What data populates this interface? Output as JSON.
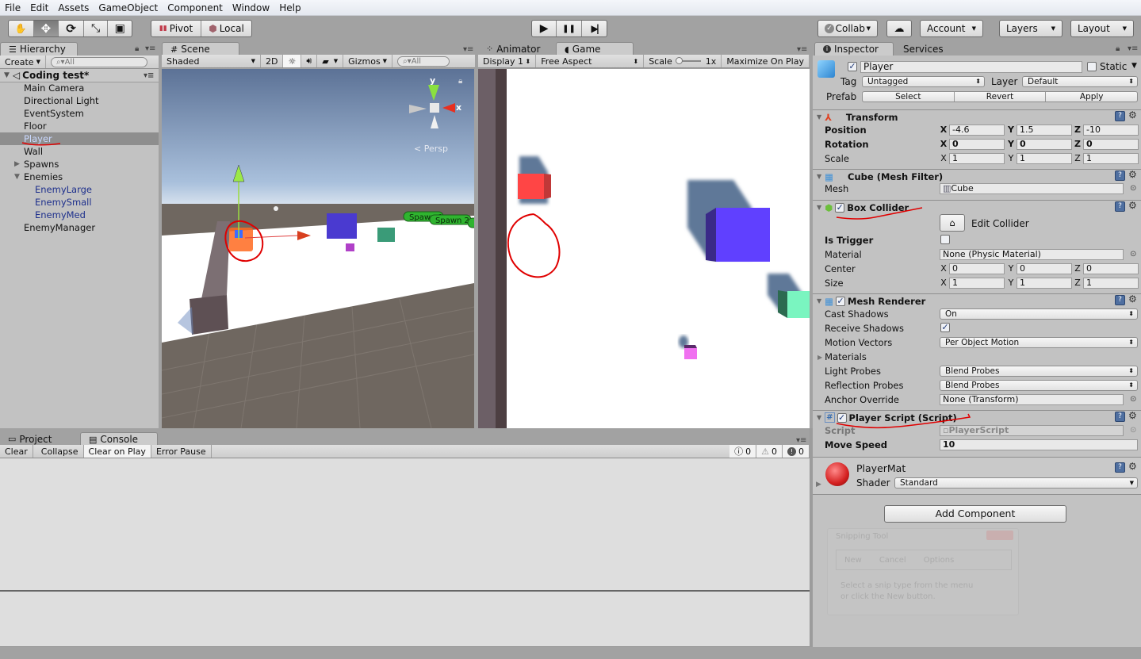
{
  "menu": [
    "File",
    "Edit",
    "Assets",
    "GameObject",
    "Component",
    "Window",
    "Help"
  ],
  "toolbar": {
    "tools": [
      {
        "name": "hand-tool",
        "icon": "✋"
      },
      {
        "name": "move-tool",
        "icon": "✥"
      },
      {
        "name": "rotate-tool",
        "icon": "⟳"
      },
      {
        "name": "scale-tool",
        "icon": "⤡"
      },
      {
        "name": "rect-tool",
        "icon": "▣"
      }
    ],
    "pivot_label": "Pivot",
    "local_label": "Local",
    "play_icon": "▶",
    "pause_icon": "❚❚",
    "step_icon": "▶|",
    "collab_label": "Collab",
    "cloud_icon": "☁",
    "account_label": "Account",
    "layers_label": "Layers",
    "layout_label": "Layout"
  },
  "hierarchy": {
    "tab_label": "Hierarchy",
    "create_label": "Create",
    "search_placeholder": "All",
    "scene_name": "Coding test*",
    "items": [
      {
        "label": "Main Camera",
        "indent": 0,
        "state": "normal"
      },
      {
        "label": "Directional Light",
        "indent": 0,
        "state": "normal"
      },
      {
        "label": "EventSystem",
        "indent": 0,
        "state": "normal"
      },
      {
        "label": "Floor",
        "indent": 0,
        "state": "normal"
      },
      {
        "label": "Player",
        "indent": 0,
        "state": "selected"
      },
      {
        "label": "Wall",
        "indent": 0,
        "state": "normal"
      },
      {
        "label": "Spawns",
        "indent": 0,
        "state": "collapsed"
      },
      {
        "label": "Enemies",
        "indent": 0,
        "state": "expanded"
      },
      {
        "label": "EnemyLarge",
        "indent": 1,
        "state": "prefab"
      },
      {
        "label": "EnemySmall",
        "indent": 1,
        "state": "prefab"
      },
      {
        "label": "EnemyMed",
        "indent": 1,
        "state": "prefab"
      },
      {
        "label": "EnemyManager",
        "indent": 0,
        "state": "normal"
      }
    ]
  },
  "scene": {
    "tab_label": "Scene",
    "shading_mode": "Shaded",
    "mode_2d_label": "2D",
    "gizmos_label": "Gizmos",
    "search_placeholder": "All",
    "persp_label": "Persp",
    "axis_y": "y",
    "axis_x": "x",
    "spawn_labels": [
      "Spawn 1",
      "Spawn 2",
      "S"
    ]
  },
  "game": {
    "animator_tab_label": "Animator",
    "tab_label": "Game",
    "display": "Display 1",
    "aspect": "Free Aspect",
    "scale_label": "Scale",
    "scale_value": "1x",
    "maximize_label": "Maximize On Play"
  },
  "inspector": {
    "tab_label": "Inspector",
    "services_tab_label": "Services",
    "object_name": "Player",
    "object_active": true,
    "static_label": "Static",
    "tag_label": "Tag",
    "tag_value": "Untagged",
    "layer_label": "Layer",
    "layer_value": "Default",
    "prefab_label": "Prefab",
    "prefab_select": "Select",
    "prefab_revert": "Revert",
    "prefab_apply": "Apply",
    "transform": {
      "title": "Transform",
      "position_label": "Position",
      "position": {
        "x": "-4.6",
        "y": "1.5",
        "z": "-10"
      },
      "rotation_label": "Rotation",
      "rotation": {
        "x": "0",
        "y": "0",
        "z": "0"
      },
      "scale_label": "Scale",
      "scale": {
        "x": "1",
        "y": "1",
        "z": "1"
      }
    },
    "mesh_filter": {
      "title": "Cube (Mesh Filter)",
      "mesh_label": "Mesh",
      "mesh_value": "Cube"
    },
    "box_collider": {
      "title": "Box Collider",
      "enabled": true,
      "edit_collider_label": "Edit Collider",
      "is_trigger_label": "Is Trigger",
      "is_trigger": false,
      "material_label": "Material",
      "material_value": "None (Physic Material)",
      "center_label": "Center",
      "center": {
        "x": "0",
        "y": "0",
        "z": "0"
      },
      "size_label": "Size",
      "size": {
        "x": "1",
        "y": "1",
        "z": "1"
      }
    },
    "mesh_renderer": {
      "title": "Mesh Renderer",
      "enabled": true,
      "cast_shadows_label": "Cast Shadows",
      "cast_shadows_value": "On",
      "receive_shadows_label": "Receive Shadows",
      "receive_shadows": true,
      "motion_vectors_label": "Motion Vectors",
      "motion_vectors_value": "Per Object Motion",
      "materials_label": "Materials",
      "light_probes_label": "Light Probes",
      "light_probes_value": "Blend Probes",
      "reflection_probes_label": "Reflection Probes",
      "reflection_probes_value": "Blend Probes",
      "anchor_override_label": "Anchor Override",
      "anchor_override_value": "None (Transform)"
    },
    "player_script": {
      "title": "Player Script (Script)",
      "enabled": true,
      "script_label": "Script",
      "script_value": "PlayerScript",
      "move_speed_label": "Move Speed",
      "move_speed_value": "10"
    },
    "material": {
      "name": "PlayerMat",
      "shader_label": "Shader",
      "shader_value": "Standard"
    },
    "add_component_label": "Add Component"
  },
  "console": {
    "project_tab_label": "Project",
    "tab_label": "Console",
    "clear_label": "Clear",
    "collapse_label": "Collapse",
    "clear_on_play_label": "Clear on Play",
    "error_pause_label": "Error Pause",
    "info_count": "0",
    "warning_count": "0",
    "error_count": "0"
  },
  "overlay": {
    "snipping_title": "Snipping Tool",
    "new_label": "New",
    "cancel_label": "Cancel",
    "options_label": "Options",
    "hint_line1": "Select a snip type from the menu",
    "hint_line2": "or click the New button."
  },
  "colors": {
    "player_cube": "#ff4545",
    "enemy_large": "#6040ff",
    "enemy_med": "#7af5c0",
    "enemy_small": "#f070f0",
    "selection_blue_text": "#1d2f8c",
    "annotation_red": "#e00000"
  }
}
